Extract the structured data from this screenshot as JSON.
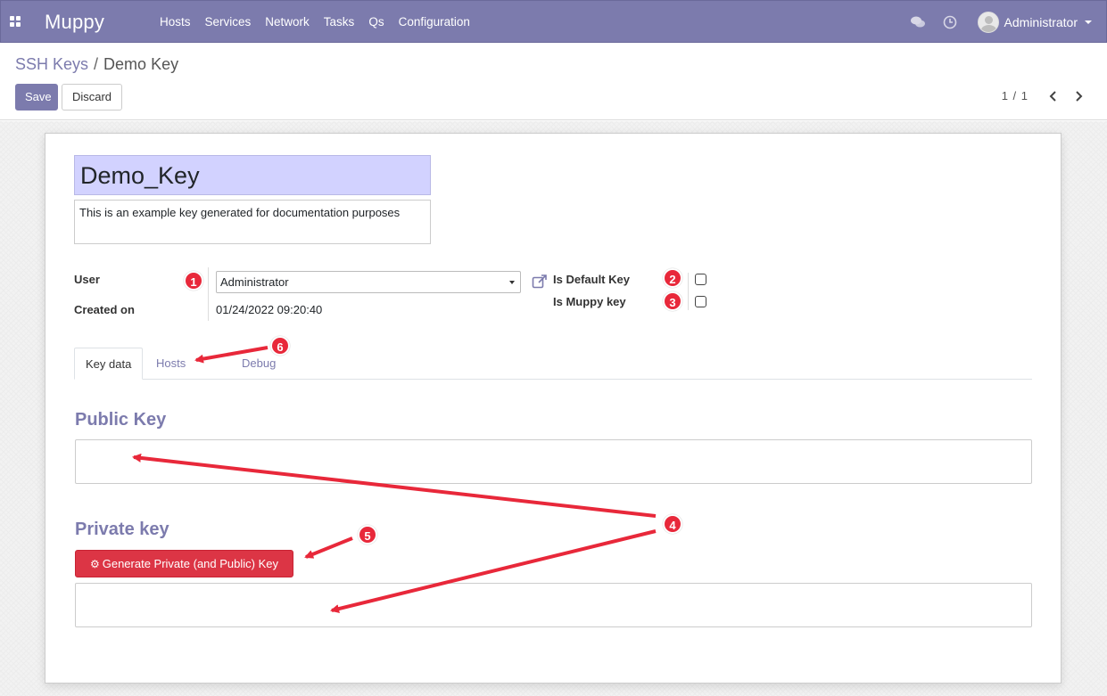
{
  "app": {
    "brand": "Muppy"
  },
  "nav": {
    "menu": [
      "Hosts",
      "Services",
      "Network",
      "Tasks",
      "Qs",
      "Configuration"
    ],
    "user_name": "Administrator"
  },
  "breadcrumb": {
    "parent": "SSH Keys",
    "separator": "/",
    "current": "Demo Key"
  },
  "toolbar": {
    "save_label": "Save",
    "discard_label": "Discard",
    "pager": "1 / 1"
  },
  "form": {
    "name": "Demo_Key",
    "description": "This is an example key generated for documentation purposes",
    "user_label": "User",
    "user_value": "Administrator",
    "created_label": "Created on",
    "created_value": "01/24/2022 09:20:40",
    "is_default_label": "Is Default Key",
    "is_default": false,
    "is_muppy_label": "Is Muppy key",
    "is_muppy": false
  },
  "tabs": [
    {
      "label": "Key data",
      "active": true
    },
    {
      "label": "Hosts",
      "active": false
    },
    {
      "label": "Debug",
      "active": false
    }
  ],
  "keydata": {
    "public_title": "Public Key",
    "public_value": "",
    "private_title": "Private key",
    "generate_label": "Generate Private (and Public) Key",
    "private_value": ""
  },
  "annotations": [
    "1",
    "2",
    "3",
    "4",
    "5",
    "6"
  ],
  "colors": {
    "primary": "#7c7bad",
    "danger": "#dc3545",
    "annotation": "#e8283a",
    "name_field": "#d2d2ff"
  }
}
